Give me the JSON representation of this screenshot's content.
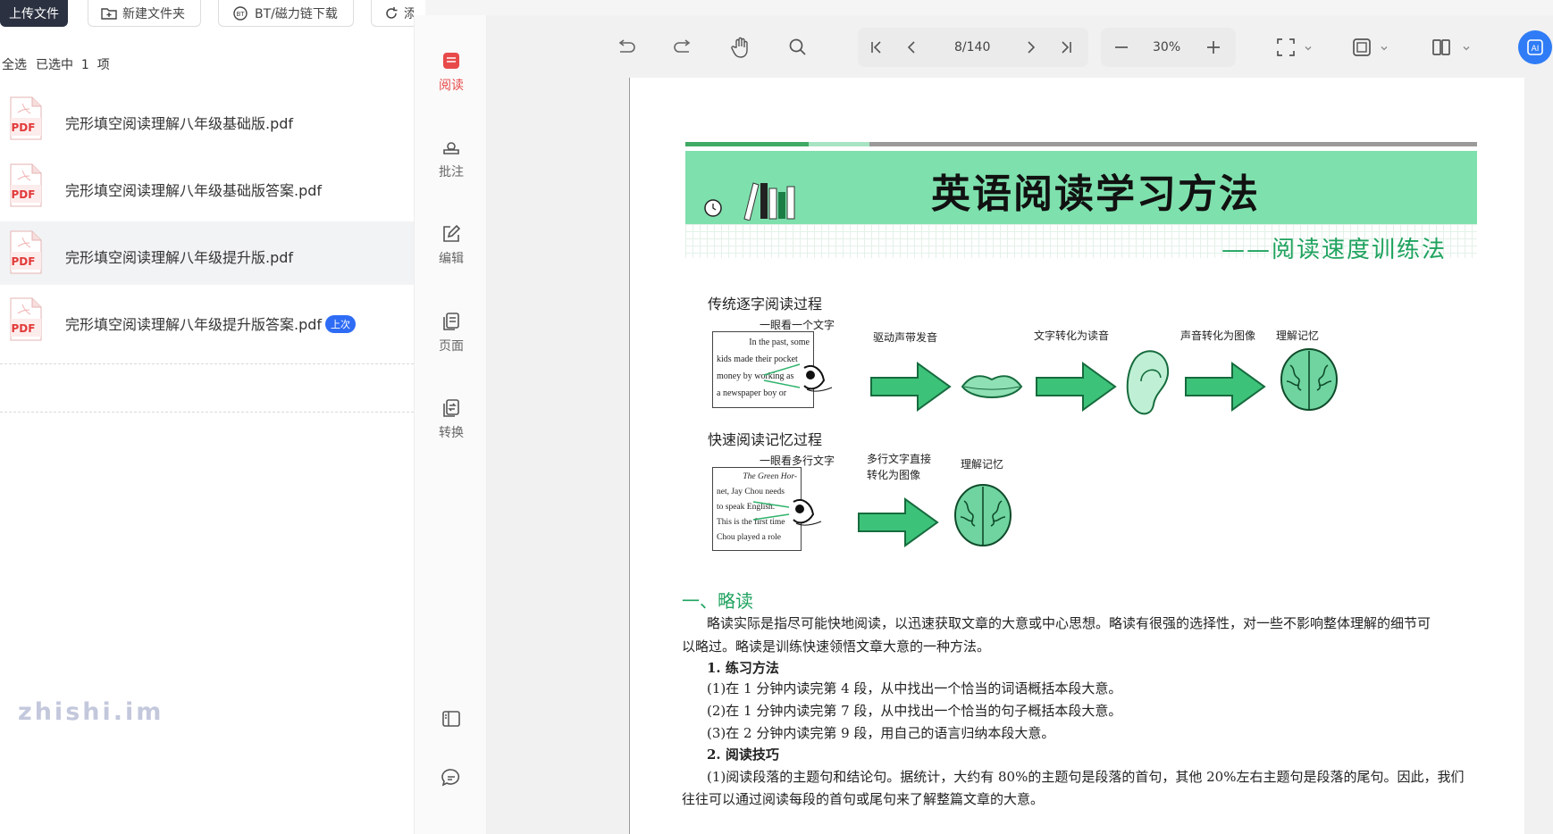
{
  "toolbar_left": {
    "upload": "上传文件",
    "new_folder": "新建文件夹",
    "bt_download": "BT/磁力链下载",
    "partial_btn": "添"
  },
  "selection": {
    "select_all": "全选",
    "selected_prefix": "已选中",
    "count": "1",
    "unit": "项"
  },
  "files": [
    {
      "name": "完形填空阅读理解八年级基础版.pdf",
      "icon": "pdf-icon",
      "selected": false
    },
    {
      "name": "完形填空阅读理解八年级基础版答案.pdf",
      "icon": "pdf-icon",
      "selected": false
    },
    {
      "name": "完形填空阅读理解八年级提升版.pdf",
      "icon": "pdf-icon",
      "selected": true
    },
    {
      "name": "完形填空阅读理解八年级提升版答案.pdf",
      "icon": "pdf-icon",
      "selected": false,
      "badge": "上次"
    }
  ],
  "watermark": "zhishi.im",
  "rail": {
    "items": [
      {
        "label": "阅读",
        "icon": "book-icon",
        "active": true
      },
      {
        "label": "批注",
        "icon": "stamp-icon",
        "active": false
      },
      {
        "label": "编辑",
        "icon": "edit-icon",
        "active": false
      },
      {
        "label": "页面",
        "icon": "pages-icon",
        "active": false
      },
      {
        "label": "转换",
        "icon": "convert-icon",
        "active": false
      }
    ]
  },
  "viewer": {
    "page_indicator": "8/140",
    "zoom": "30%",
    "accent": "#2f7cf6"
  },
  "doc": {
    "title": "英语阅读学习方法",
    "subtitle": "——阅读速度训练法",
    "trad_title": "传统逐字阅读过程",
    "trad_caption": "一眼看一个文字",
    "trad_text": [
      "In the past, some",
      "kids made their pocket",
      "money by working as",
      "a newspaper boy or"
    ],
    "trad_steps": [
      "驱动声带发音",
      "文字转化为读音",
      "声音转化为图像",
      "理解记忆"
    ],
    "fast_title": "快速阅读记忆过程",
    "fast_caption": "一眼看多行文字",
    "fast_text": [
      "The Green Hor-",
      "net, Jay Chou needs",
      "to speak English.",
      "This is the first time",
      "Chou played a role"
    ],
    "fast_step1a": "多行文字直接",
    "fast_step1b": "转化为图像",
    "fast_step2": "理解记忆",
    "section1": "一、略读",
    "para1a": "略读实际是指尽可能快地阅读，以迅速获取文章的大意或中心思想。略读有很强的选择性，对一些不影响整体理解的细节可",
    "para1b": "以略过。略读是训练快速领悟文章大意的一种方法。",
    "h_method": "1. 练习方法",
    "m1": "(1)在 1 分钟内读完第 4 段，从中找出一个恰当的词语概括本段大意。",
    "m2": "(2)在 1 分钟内读完第 7 段，从中找出一个恰当的句子概括本段大意。",
    "m3": "(3)在 2 分钟内读完第 9 段，用自己的语言归纳本段大意。",
    "h_skill": "2. 阅读技巧",
    "s1a": "(1)阅读段落的主题句和结论句。据统计，大约有 80%的主题句是段落的首句，其他 20%左右主题句是段落的尾句。因此，我们",
    "s1b": "往往可以通过阅读每段的首句或尾句来了解整篇文章的大意。"
  }
}
